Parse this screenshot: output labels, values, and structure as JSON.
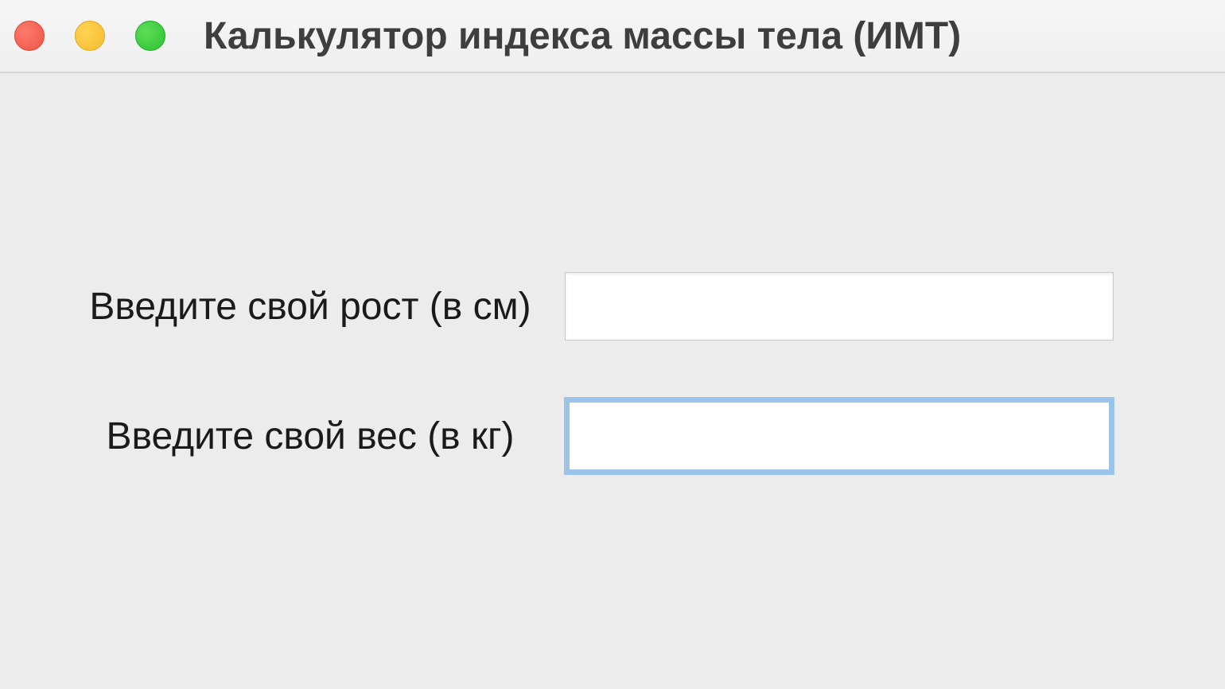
{
  "window": {
    "title": "Калькулятор индекса массы тела (ИМТ)"
  },
  "form": {
    "height_label": "Введите свой рост (в см)",
    "height_value": "",
    "weight_label": "Введите свой вес (в кг)",
    "weight_value": ""
  }
}
